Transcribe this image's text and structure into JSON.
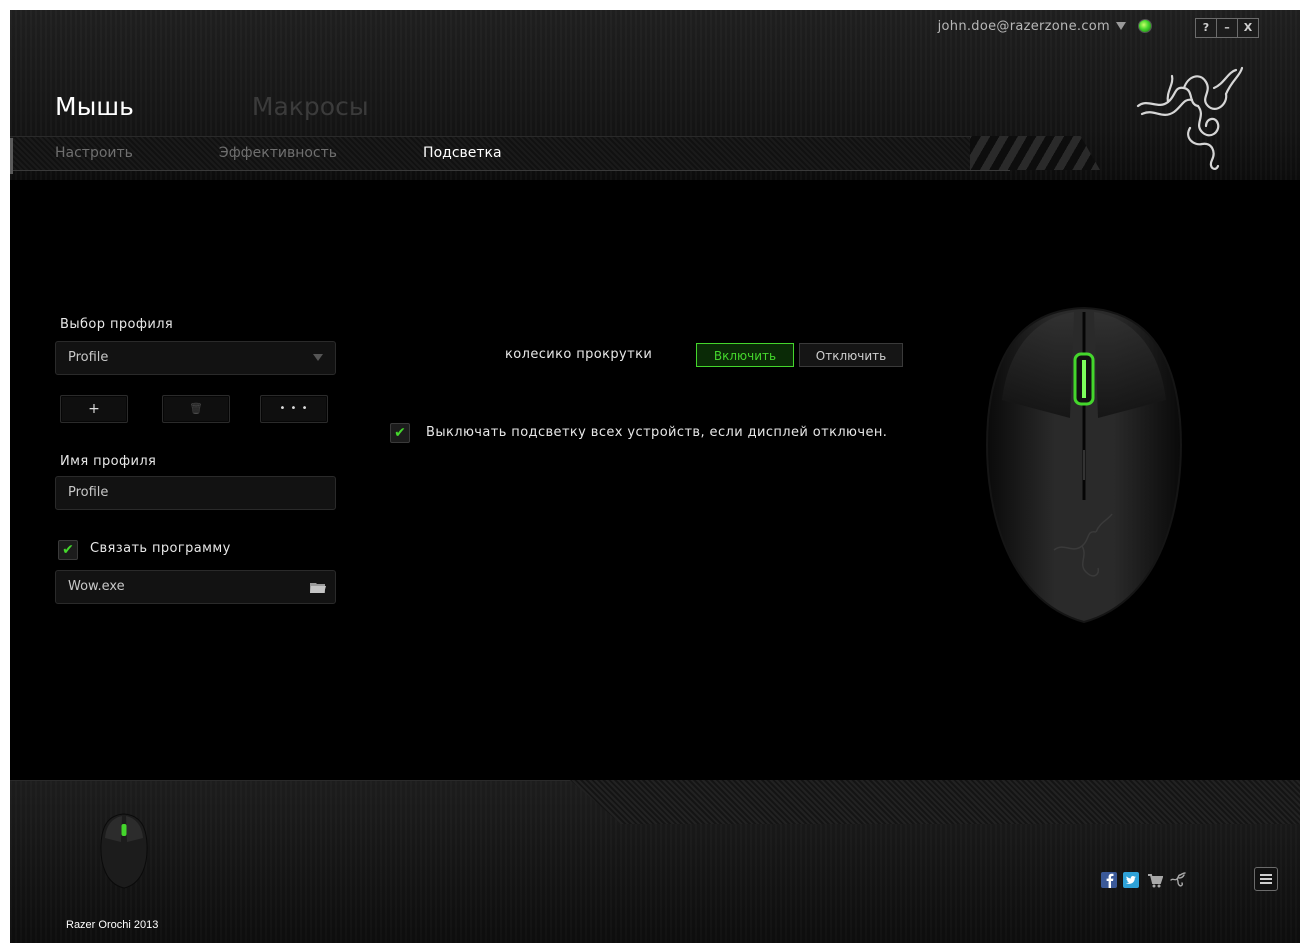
{
  "window": {
    "account_email": "john.doe@razerzone.com",
    "controls": {
      "help": "?",
      "minimize": "–",
      "close": "X"
    }
  },
  "main_tabs": [
    {
      "label": "Мышь",
      "active": true
    },
    {
      "label": "Макросы",
      "active": false
    }
  ],
  "sub_tabs": [
    {
      "label": "Настроить",
      "active": false
    },
    {
      "label": "Эффективность",
      "active": false
    },
    {
      "label": "Подсветка",
      "active": true
    }
  ],
  "profile_panel": {
    "select_label": "Выбор профиля",
    "selected_profile": "Profile",
    "add_label": "+",
    "delete_label": "🗑",
    "more_label": "• • •",
    "name_label": "Имя профиля",
    "name_value": "Profile",
    "link_label": "Связать программу",
    "link_checked": true,
    "program_value": "Wow.exe"
  },
  "lighting": {
    "scroll_label": "колесико прокрутки",
    "on_label": "Включить",
    "off_label": "Отключить",
    "state": "on",
    "display_off_label": "Выключать подсветку всех устройств, если дисплей отключен.",
    "display_off_checked": true
  },
  "footer": {
    "device_name": "Razer Orochi 2013"
  },
  "icons": [
    "status-dot-icon",
    "dropdown-arrow-icon",
    "folder-icon",
    "facebook-icon",
    "twitter-icon",
    "cart-icon",
    "razer-logo-icon",
    "menu-icon"
  ],
  "colors": {
    "accent": "#44d62c",
    "background": "#000000"
  }
}
